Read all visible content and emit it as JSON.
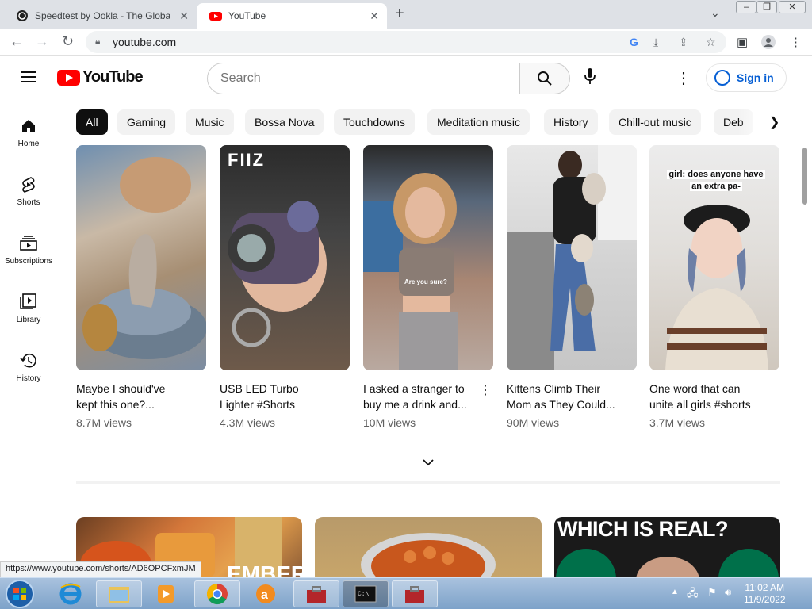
{
  "browser": {
    "tabs": [
      {
        "title": "Speedtest by Ookla - The Global",
        "active": false
      },
      {
        "title": "YouTube",
        "active": true
      }
    ],
    "new_tab_label": "+",
    "url": "youtube.com",
    "status_url": "https://www.youtube.com/shorts/AD6OPCFxmJM"
  },
  "youtube": {
    "logo_text": "YouTube",
    "search_placeholder": "Search",
    "sign_in_label": "Sign in",
    "nav": [
      {
        "label": "Home",
        "icon": "home-icon"
      },
      {
        "label": "Shorts",
        "icon": "shorts-icon"
      },
      {
        "label": "Subscriptions",
        "icon": "subscriptions-icon"
      },
      {
        "label": "Library",
        "icon": "library-icon"
      },
      {
        "label": "History",
        "icon": "history-icon"
      }
    ],
    "chips": [
      "All",
      "Gaming",
      "Music",
      "Bossa Nova",
      "Touchdowns",
      "Meditation music",
      "History",
      "Chill-out music",
      "Deb"
    ],
    "shorts": [
      {
        "title_line1": "Maybe I should've",
        "title_line2": "kept this one?...",
        "views": "8.7M views"
      },
      {
        "title_line1": "USB LED Turbo",
        "title_line2": "Lighter #Shorts",
        "views": "4.3M views"
      },
      {
        "title_line1": "I asked a stranger to",
        "title_line2": "buy me a drink and...",
        "views": "10M views"
      },
      {
        "title_line1": "Kittens Climb Their",
        "title_line2": "Mom as They Could...",
        "views": "90M views"
      },
      {
        "title_line1": "One word that can",
        "title_line2": "unite all girls #shorts",
        "views": "3.7M views"
      }
    ],
    "thumb_overlays": {
      "fiiz": "FIIZ",
      "are_you_sure": "Are you sure?",
      "girl_caption_line1": "girl: does anyone have",
      "girl_caption_line2": "an extra pa-",
      "which_is_real": "WHICH IS REAL?",
      "ember": "EMBER"
    }
  },
  "taskbar": {
    "time": "11:02 AM",
    "date": "11/9/2022"
  },
  "colors": {
    "yt_red": "#ff0000",
    "link_blue": "#065fd4",
    "chip_bg": "#f2f2f2"
  }
}
